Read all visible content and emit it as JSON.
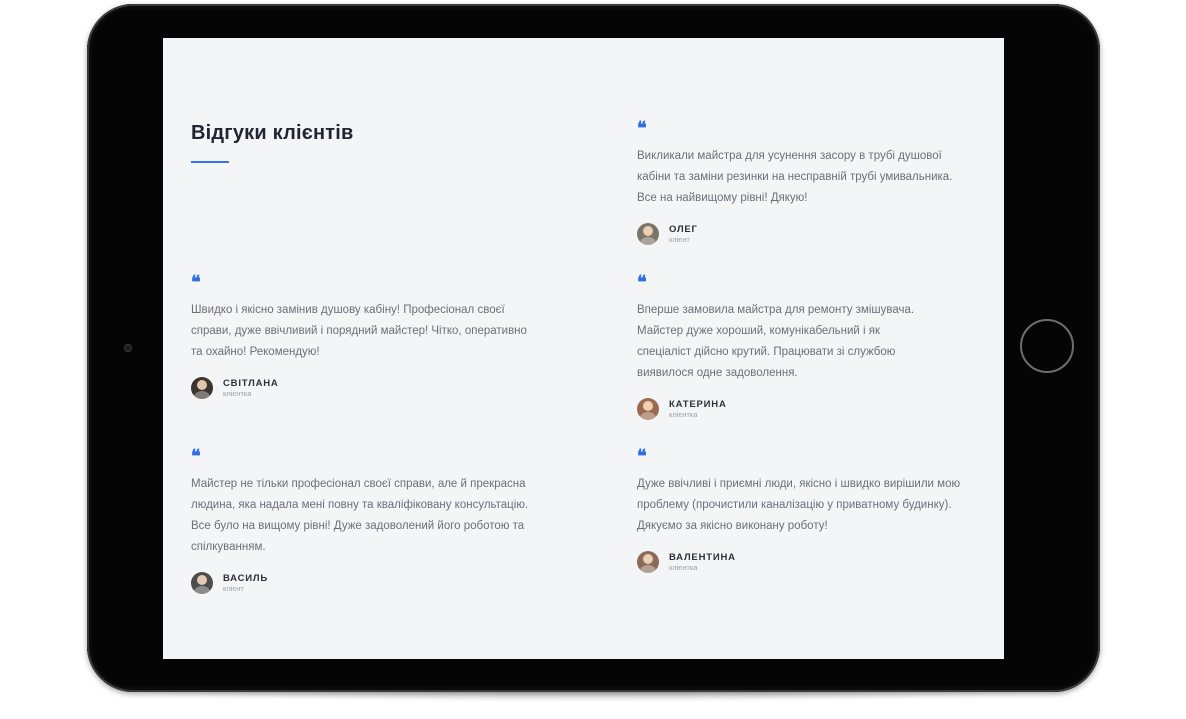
{
  "section": {
    "title": "Відгуки клієнтів",
    "quote_glyph": "❝"
  },
  "colors": {
    "accent": "#2f6fe4",
    "screen_background": "#f4f5f7",
    "device_frame": "#050505"
  },
  "reviews": [
    {
      "text": "Викликали майстра для усунення засору в трубі душової кабіни та заміни резинки на несправній трубі умивальника. Все на найвищому рівні! Дякую!",
      "author": "ОЛЕГ",
      "role": "клієнт",
      "avatar_color": "#7d7468"
    },
    {
      "text": "Швидко і якісно замінив душову кабіну! Професіонал своєї справи, дуже ввічливий і порядний майстер! Чітко, оперативно та охайно! Рекомендую!",
      "author": "СВІТЛАНА",
      "role": "клієнтка",
      "avatar_color": "#3b342f"
    },
    {
      "text": "Вперше замовила майстра для ремонту змішувача. Майстер дуже хороший, комунікабельний і як спеціаліст дійсно крутий. Працювати зі службою виявилося одне задоволення.",
      "author": "КАТЕРИНА",
      "role": "клієнтка",
      "avatar_color": "#9a6a4e"
    },
    {
      "text": "Майстер не тільки професіонал своєї справи, але й прекрасна людина, яка надала мені повну та кваліфіковану консультацію. Все було на вищому рівні! Дуже задоволений його роботою та спілкуванням.",
      "author": "ВАСИЛЬ",
      "role": "клієнт",
      "avatar_color": "#4e4d4b"
    },
    {
      "text": "Дуже ввічливі і приємні люди, якісно і швидко вирішили мою проблему (прочистили каналізацію у приватному будинку). Дякуємо за якісно виконану роботу!",
      "author": "ВАЛЕНТИНА",
      "role": "клієнтка",
      "avatar_color": "#8a6a58"
    }
  ]
}
